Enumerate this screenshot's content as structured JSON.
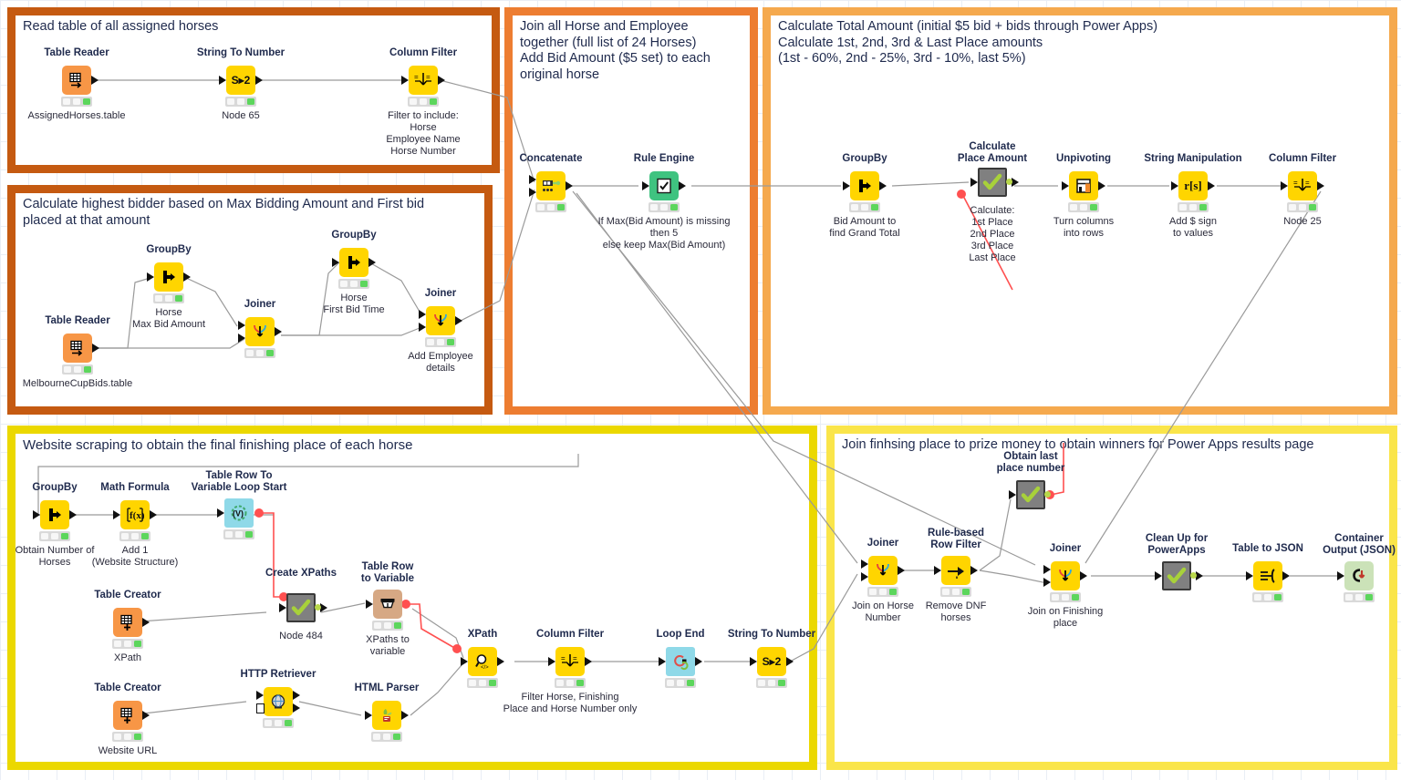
{
  "app": {
    "name": "KNIME Analytics Platform workflow canvas"
  },
  "colors": {
    "frame_dark_orange": "#C55A11",
    "frame_orange": "#ED7D31",
    "frame_light_orange": "#F5A94E",
    "frame_yellow": "#EBD800",
    "frame_light_yellow": "#FAE54A",
    "node_yellow": "#FFD500",
    "node_orange": "#F79646",
    "node_green": "#3FC380",
    "node_cyan": "#8FD9E8",
    "node_brown": "#D6A884",
    "node_grey": "#808080",
    "node_palegreen": "#CBE2B8",
    "wire": "#9a9a9a",
    "wire_variable": "#FF5050",
    "status_green": "#5CD65C"
  },
  "frames": [
    {
      "id": "frame-assigned-horses",
      "title": "Read table of all assigned horses",
      "border": "#C55A11"
    },
    {
      "id": "frame-highest-bidder",
      "title": "Calculate highest bidder based on Max Bidding Amount and First bid\nplaced at that amount",
      "border": "#C55A11"
    },
    {
      "id": "frame-join-horse-employee",
      "title": "Join all Horse and Employee\ntogether (full list of 24 Horses)\nAdd Bid Amount ($5 set) to each\noriginal horse",
      "border": "#ED7D31"
    },
    {
      "id": "frame-calculate-total",
      "title": "Calculate Total Amount (initial $5 bid + bids through Power Apps)\nCalculate 1st, 2nd, 3rd & Last Place amounts\n(1st - 60%, 2nd - 25%, 3rd - 10%, last 5%)",
      "border": "#F5A94E"
    },
    {
      "id": "frame-website-scraping",
      "title": "Website scraping to obtain the final finishing place of each horse",
      "border": "#EBD800"
    },
    {
      "id": "frame-join-prize",
      "title": "Join finhsing place to prize money to obtain winners for Power Apps results page",
      "border": "#FAE54A"
    }
  ],
  "nodes": [
    {
      "id": "table-reader-assigned",
      "title": "Table Reader",
      "sub": "AssignedHorses.table",
      "icon": "table-reader-icon"
    },
    {
      "id": "string-to-number-65",
      "title": "String To Number",
      "sub": "Node 65",
      "icon": "string-to-number-icon"
    },
    {
      "id": "column-filter-assigned",
      "title": "Column Filter",
      "sub": "Filter to include:\nHorse\nEmployee Name\nHorse Number",
      "icon": "column-filter-icon"
    },
    {
      "id": "table-reader-bids",
      "title": "Table Reader",
      "sub": "MelbourneCupBids.table",
      "icon": "table-reader-icon"
    },
    {
      "id": "groupby-maxbid",
      "title": "GroupBy",
      "sub": "Horse\nMax Bid Amount",
      "icon": "groupby-icon"
    },
    {
      "id": "joiner-maxbid",
      "title": "Joiner",
      "sub": "",
      "icon": "joiner-icon"
    },
    {
      "id": "groupby-firstbid",
      "title": "GroupBy",
      "sub": "Horse\nFirst Bid Time",
      "icon": "groupby-icon"
    },
    {
      "id": "joiner-employee",
      "title": "Joiner",
      "sub": "Add Employee\ndetails",
      "icon": "joiner-icon"
    },
    {
      "id": "concatenate",
      "title": "Concatenate",
      "sub": "",
      "icon": "concatenate-icon"
    },
    {
      "id": "rule-engine",
      "title": "Rule Engine",
      "sub": "If Max(Bid Amount) is missing\nthen 5\nelse keep Max(Bid Amount)",
      "icon": "rule-engine-icon"
    },
    {
      "id": "groupby-grandtotal",
      "title": "GroupBy",
      "sub": "Bid Amount to\nfind Grand Total",
      "icon": "groupby-icon"
    },
    {
      "id": "calculate-place-amount",
      "title": "Calculate\nPlace Amount",
      "sub": "Calculate:\n1st Place\n2nd Place\n3rd Place\nLast Place",
      "icon": "component-check-icon"
    },
    {
      "id": "unpivoting",
      "title": "Unpivoting",
      "sub": "Turn columns\ninto rows",
      "icon": "unpivoting-icon"
    },
    {
      "id": "string-manipulation",
      "title": "String Manipulation",
      "sub": "Add $ sign\nto values",
      "icon": "string-manipulation-icon"
    },
    {
      "id": "column-filter-25",
      "title": "Column Filter",
      "sub": "Node 25",
      "icon": "column-filter-icon"
    },
    {
      "id": "groupby-numhorses",
      "title": "GroupBy",
      "sub": "Obtain Number of\nHorses",
      "icon": "groupby-icon"
    },
    {
      "id": "math-formula",
      "title": "Math Formula",
      "sub": "Add 1\n(Website Structure)",
      "icon": "math-formula-icon"
    },
    {
      "id": "table-row-to-var-loop",
      "title": "Table Row To\nVariable Loop Start",
      "sub": "",
      "icon": "loop-start-icon"
    },
    {
      "id": "table-creator-xpath",
      "title": "Table Creator",
      "sub": "XPath",
      "icon": "table-creator-icon"
    },
    {
      "id": "create-xpaths",
      "title": "Create XPaths",
      "sub": "Node 484",
      "icon": "component-check-icon"
    },
    {
      "id": "table-row-to-variable",
      "title": "Table Row\nto Variable",
      "sub": "XPaths to\nvariable",
      "icon": "table-row-to-variable-icon"
    },
    {
      "id": "table-creator-url",
      "title": "Table Creator",
      "sub": "Website URL",
      "icon": "table-creator-icon"
    },
    {
      "id": "http-retriever",
      "title": "HTTP Retriever",
      "sub": "",
      "icon": "http-retriever-icon"
    },
    {
      "id": "html-parser",
      "title": "HTML Parser",
      "sub": "",
      "icon": "html-parser-icon"
    },
    {
      "id": "xpath",
      "title": "XPath",
      "sub": "",
      "icon": "xpath-icon"
    },
    {
      "id": "column-filter-scrape",
      "title": "Column Filter",
      "sub": "Filter Horse, Finishing\nPlace and Horse Number only",
      "icon": "column-filter-icon"
    },
    {
      "id": "loop-end",
      "title": "Loop End",
      "sub": "",
      "icon": "loop-end-icon"
    },
    {
      "id": "string-to-number-scrape",
      "title": "String To Number",
      "sub": "",
      "icon": "string-to-number-icon"
    },
    {
      "id": "joiner-horsenumber",
      "title": "Joiner",
      "sub": "Join on Horse\nNumber",
      "icon": "joiner-icon"
    },
    {
      "id": "rule-based-row-filter",
      "title": "Rule-based\nRow Filter",
      "sub": "Remove DNF\nhorses",
      "icon": "row-filter-icon"
    },
    {
      "id": "obtain-last-place",
      "title": "Obtain last\nplace number",
      "sub": "",
      "icon": "component-check-icon"
    },
    {
      "id": "joiner-finishingplace",
      "title": "Joiner",
      "sub": "Join on Finishing\nplace",
      "icon": "joiner-icon"
    },
    {
      "id": "clean-up-powerapps",
      "title": "Clean Up for\nPowerApps",
      "sub": "",
      "icon": "component-check-icon"
    },
    {
      "id": "table-to-json",
      "title": "Table to JSON",
      "sub": "",
      "icon": "table-to-json-icon"
    },
    {
      "id": "container-output-json",
      "title": "Container\nOutput (JSON)",
      "sub": "",
      "icon": "container-output-icon"
    }
  ]
}
